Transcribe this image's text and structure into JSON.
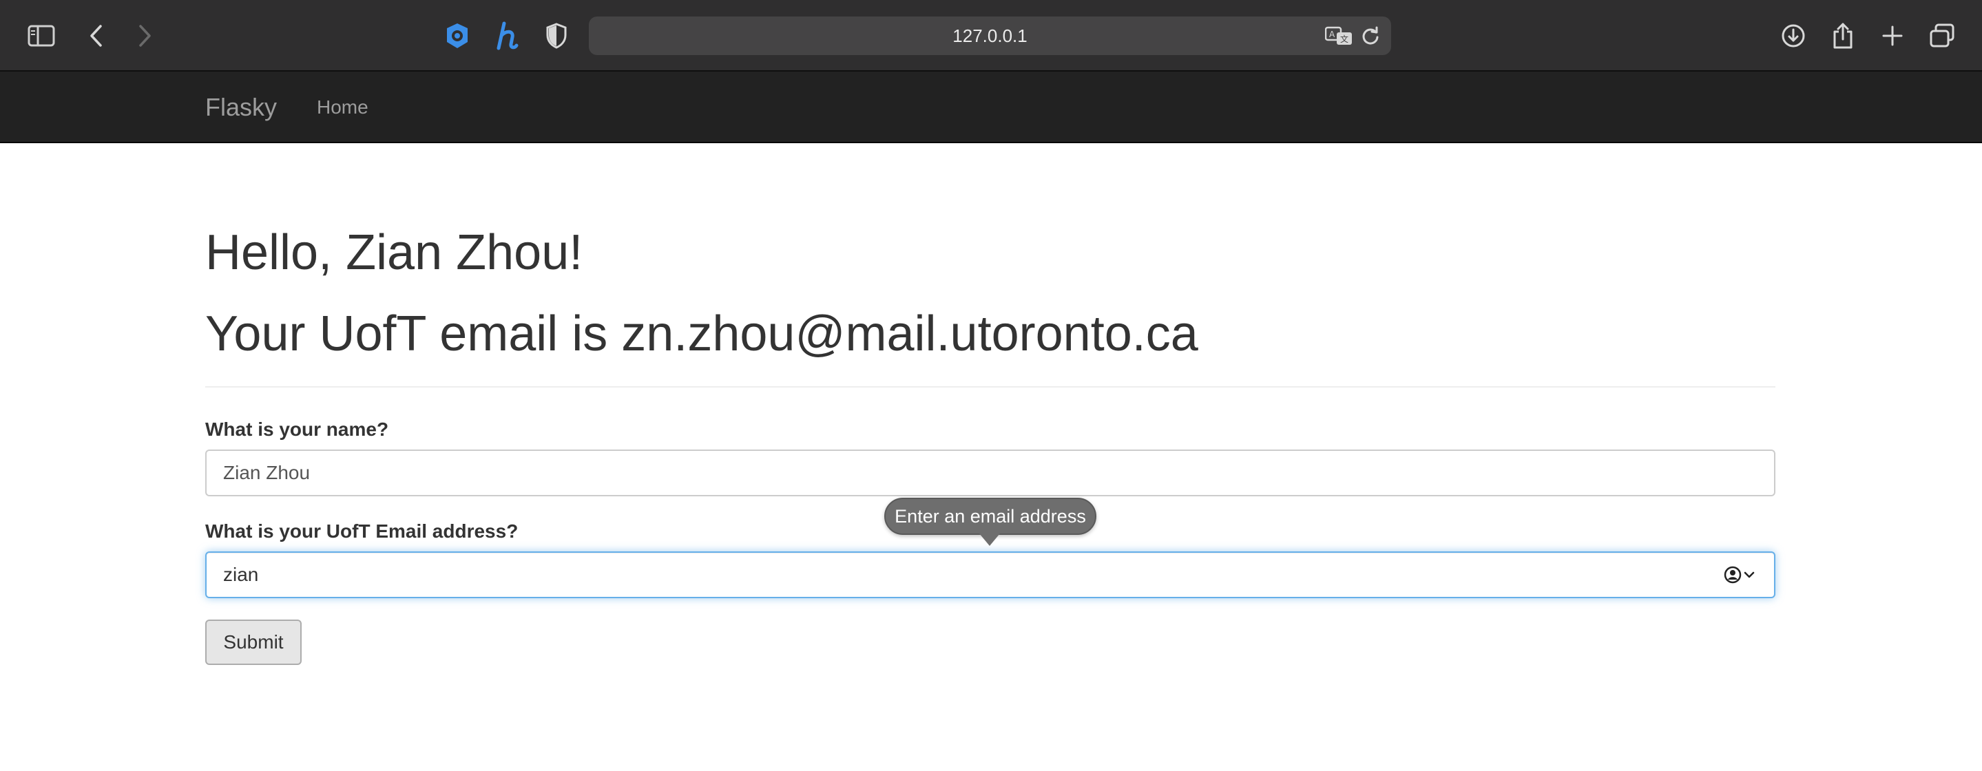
{
  "browser": {
    "url": "127.0.0.1",
    "icons": [
      "sidebar-icon",
      "back-icon",
      "forward-icon",
      "extension-blue-icon",
      "honey-icon",
      "privacy-shield-icon",
      "translate-icon",
      "reload-icon",
      "download-icon",
      "share-icon",
      "new-tab-icon",
      "tab-overview-icon"
    ]
  },
  "navbar": {
    "brand": "Flasky",
    "home": "Home"
  },
  "page": {
    "greeting": "Hello, Zian Zhou!",
    "email_heading": "Your UofT email is zn.zhou@mail.utoronto.ca"
  },
  "form": {
    "name_label": "What is your name?",
    "name_value": "Zian Zhou",
    "email_label": "What is your UofT Email address?",
    "email_value": "zian",
    "submit_label": "Submit",
    "validation_tooltip": "Enter an email address"
  },
  "colors": {
    "chrome_bg": "#2f2e2f",
    "navbar_bg": "#222222",
    "focus_ring": "#66afe9",
    "extension_blue": "#3b8ee8"
  }
}
